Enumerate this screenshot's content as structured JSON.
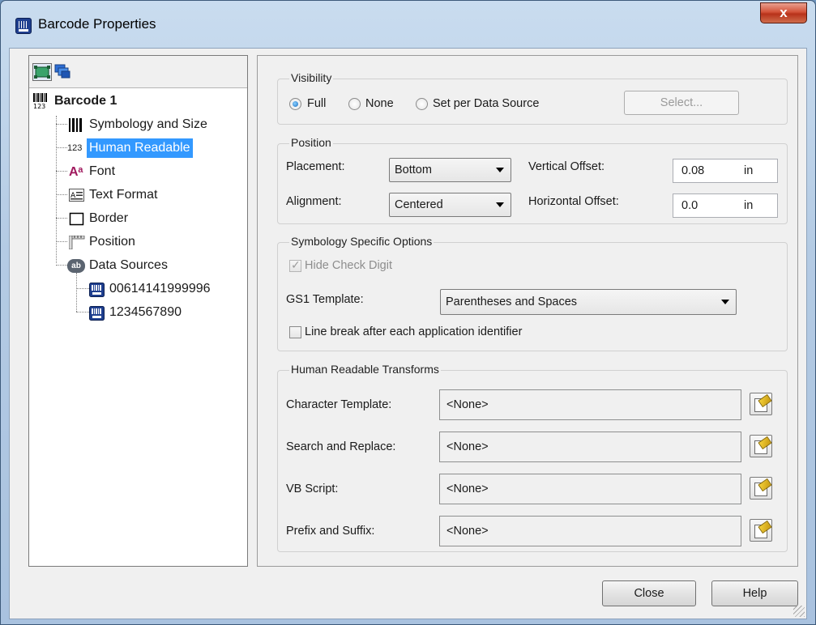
{
  "window": {
    "title": "Barcode Properties",
    "close_label": "x"
  },
  "tree": {
    "root": "Barcode 1",
    "items": [
      {
        "label": "Symbology and Size",
        "icon": "barcode-icon"
      },
      {
        "label": "Human Readable",
        "icon": "numbers-123-icon",
        "selected": true
      },
      {
        "label": "Font",
        "icon": "font-icon"
      },
      {
        "label": "Text Format",
        "icon": "text-format-icon"
      },
      {
        "label": "Border",
        "icon": "border-icon"
      },
      {
        "label": "Position",
        "icon": "ruler-icon"
      },
      {
        "label": "Data Sources",
        "icon": "data-source-icon"
      }
    ],
    "data_sources": [
      {
        "label": "00614141999996",
        "icon": "datasource-item-icon"
      },
      {
        "label": "1234567890",
        "icon": "datasource-item-icon"
      }
    ],
    "root_icon_text": "123",
    "item_icon_123": "123",
    "item_icon_font": "Aᵃ",
    "item_icon_ab": "ab"
  },
  "visibility": {
    "group_label": "Visibility",
    "options": [
      "Full",
      "None",
      "Set per Data Source"
    ],
    "selected": "Full",
    "select_button": "Select..."
  },
  "position": {
    "group_label": "Position",
    "placement_label": "Placement:",
    "placement_value": "Bottom",
    "alignment_label": "Alignment:",
    "alignment_value": "Centered",
    "vertical_offset_label": "Vertical Offset:",
    "vertical_offset_value": "0.08",
    "horizontal_offset_label": "Horizontal Offset:",
    "horizontal_offset_value": "0.0",
    "unit": "in"
  },
  "symbology": {
    "group_label": "Symbology Specific Options",
    "hide_check_digit_label": "Hide Check Digit",
    "gs1_template_label": "GS1 Template:",
    "gs1_template_value": "Parentheses and Spaces",
    "line_break_label": "Line break after each application identifier"
  },
  "transforms": {
    "group_label": "Human Readable Transforms",
    "rows": [
      {
        "label": "Character Template:",
        "value": "<None>"
      },
      {
        "label": "Search and Replace:",
        "value": "<None>"
      },
      {
        "label": "VB Script:",
        "value": "<None>"
      },
      {
        "label": "Prefix and Suffix:",
        "value": "<None>"
      }
    ]
  },
  "footer": {
    "close": "Close",
    "help": "Help"
  }
}
